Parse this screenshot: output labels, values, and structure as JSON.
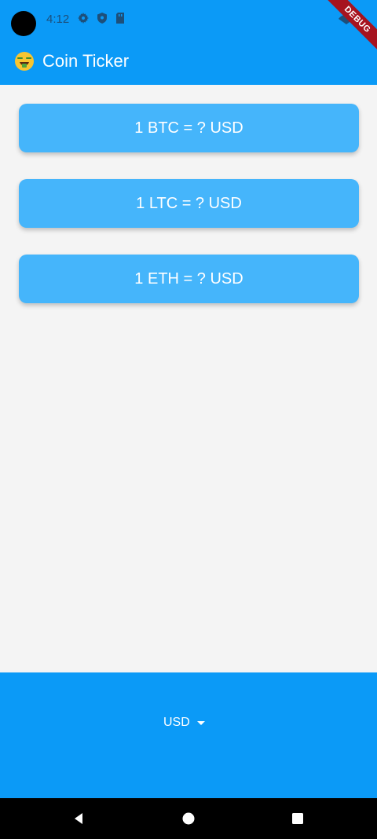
{
  "status_bar": {
    "time": "4:12",
    "icons": [
      "gear-icon",
      "shield-icon",
      "sd-card-icon",
      "signal-icon"
    ],
    "debug_banner": "DEBUG"
  },
  "app_bar": {
    "emoji": "money-mouth-face-icon",
    "title": "Coin Ticker"
  },
  "cards": [
    {
      "label": "1 BTC = ? USD"
    },
    {
      "label": "1 LTC = ? USD"
    },
    {
      "label": "1 ETH = ? USD"
    }
  ],
  "currency_picker": {
    "selected": "USD",
    "icon": "dropdown-arrow-icon"
  },
  "navigation_bar": {
    "icons": [
      "back-icon",
      "home-icon",
      "recents-icon"
    ]
  },
  "colors": {
    "primary": "#0b9af7",
    "card": "#45b5fb",
    "background": "#f4f4f4",
    "text": "#ffffff"
  }
}
